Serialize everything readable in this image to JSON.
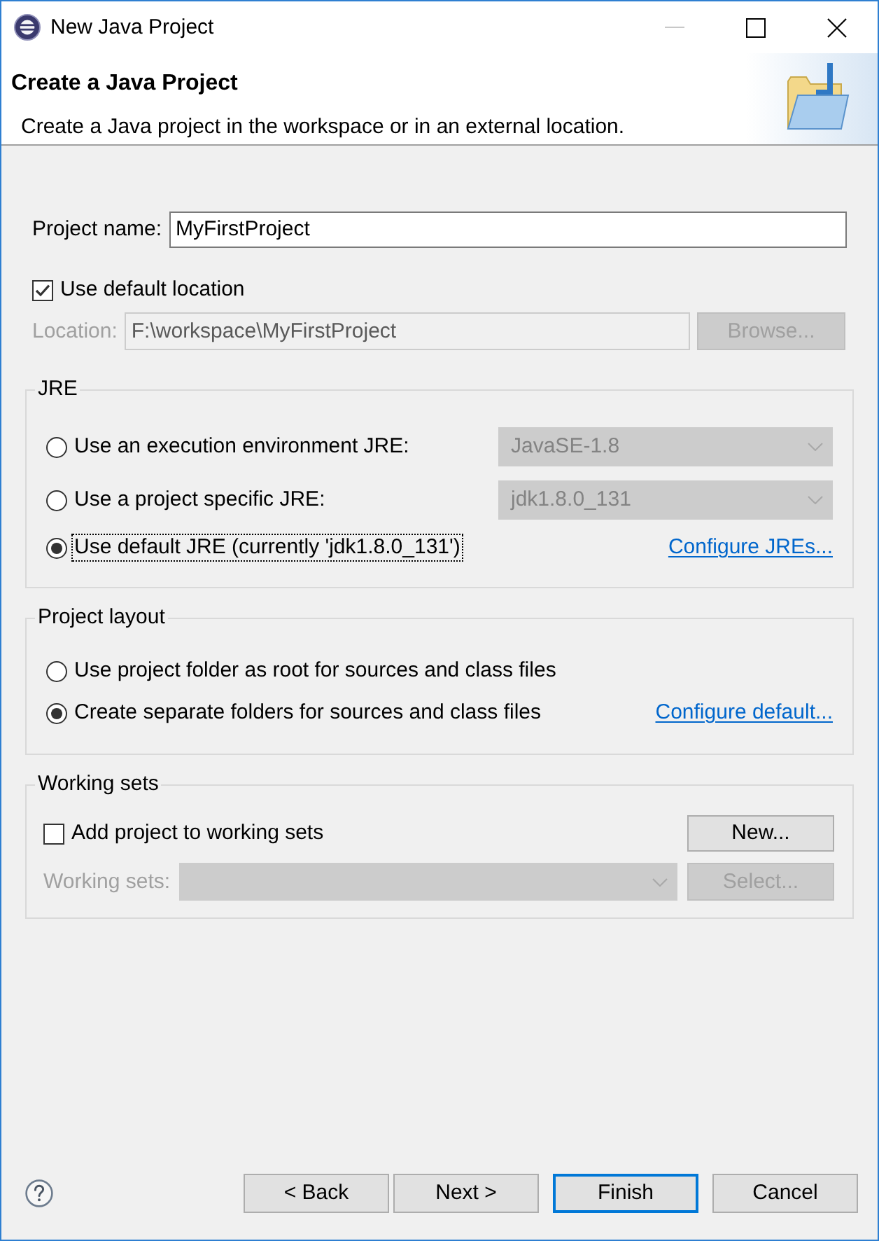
{
  "window": {
    "title": "New Java Project",
    "minimize": {
      "disabled": true
    }
  },
  "header": {
    "title": "Create a Java Project",
    "description": "Create a Java project in the workspace or in an external location."
  },
  "project_name": {
    "label": "Project name:",
    "value": "MyFirstProject"
  },
  "default_location": {
    "label": "Use default location",
    "checked": true
  },
  "location": {
    "label": "Location:",
    "value": "F:\\workspace\\MyFirstProject",
    "disabled": true,
    "button": {
      "label": "Browse...",
      "disabled": true
    }
  },
  "jre": {
    "title": "JRE",
    "options": [
      {
        "kind": "combo",
        "label": "Use an execution environment JRE:",
        "selected": false,
        "focused": false,
        "combo": {
          "value": "JavaSE-1.8",
          "disabled": true
        }
      },
      {
        "kind": "combo",
        "label": "Use a project specific JRE:",
        "selected": false,
        "focused": false,
        "combo": {
          "value": "jdk1.8.0_131",
          "disabled": true
        }
      },
      {
        "kind": "link",
        "label": "Use default JRE (currently 'jdk1.8.0_131')",
        "selected": true,
        "focused": true,
        "link": "Configure JREs..."
      }
    ]
  },
  "project_layout": {
    "title": "Project layout",
    "options": [
      {
        "kind": "plain",
        "label": "Use project folder as root for sources and class files",
        "selected": false
      },
      {
        "kind": "link",
        "label": "Create separate folders for sources and class files",
        "selected": true,
        "link": "Configure default..."
      }
    ]
  },
  "working_sets": {
    "title": "Working sets",
    "add": {
      "label": "Add project to working sets",
      "checked": false,
      "button": {
        "label": "New...",
        "disabled": false
      }
    },
    "sets": {
      "label": "Working sets:",
      "disabled": true,
      "button": {
        "label": "Select...",
        "disabled": true
      }
    }
  },
  "buttons": [
    {
      "label": "< Back",
      "default": false
    },
    {
      "label": "Next >",
      "default": false
    },
    {
      "label": "Finish",
      "default": true
    },
    {
      "label": "Cancel",
      "default": false
    }
  ]
}
